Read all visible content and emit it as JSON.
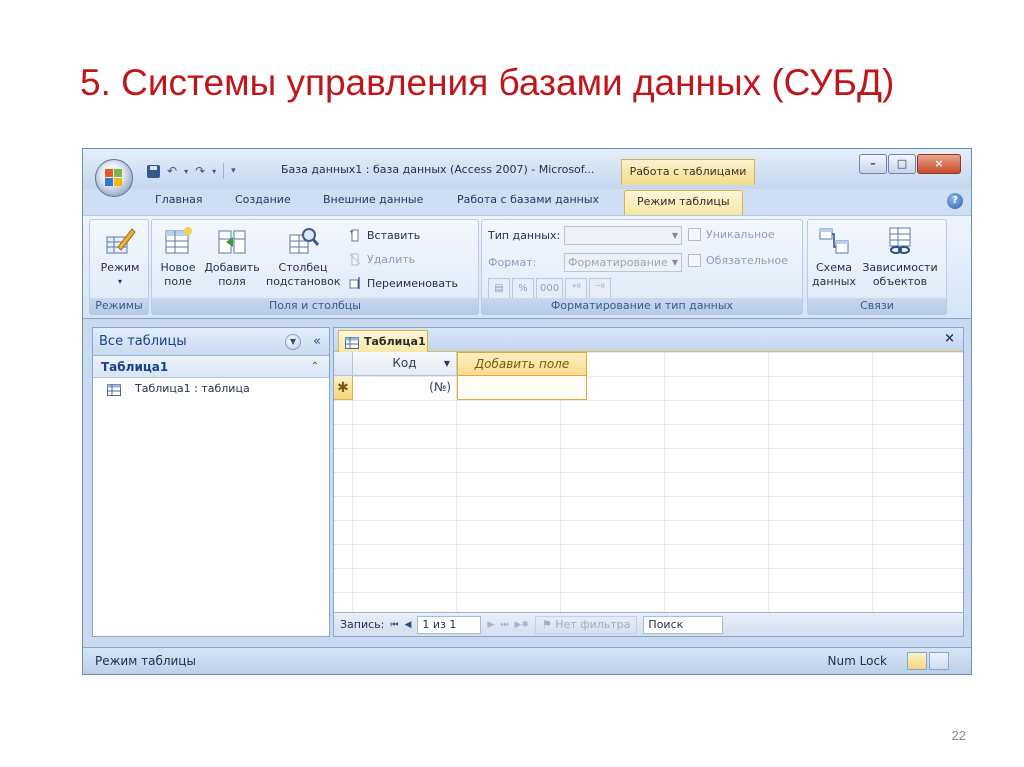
{
  "slide": {
    "title": "5. Системы управления базами данных (СУБД)",
    "page_number": "22"
  },
  "window": {
    "title": "База данных1 : база данных (Access 2007) - Microsof...",
    "context_tab": "Работа с таблицами",
    "controls": {
      "minimize": "–",
      "maximize": "□",
      "close": "×"
    }
  },
  "ribbon": {
    "tabs": [
      "Главная",
      "Создание",
      "Внешние данные",
      "Работа с базами данных",
      "Режим таблицы"
    ],
    "active_tab": "Режим таблицы",
    "groups": {
      "views": {
        "label": "Режимы",
        "mode_button": "Режим"
      },
      "fields": {
        "label": "Поля и столбцы",
        "new_field": [
          "Новое",
          "поле"
        ],
        "add_fields": [
          "Добавить",
          "поля"
        ],
        "lookup_column": [
          "Столбец",
          "подстановок"
        ],
        "insert": "Вставить",
        "delete": "Удалить",
        "rename": "Переименовать"
      },
      "format": {
        "label": "Форматирование и тип данных",
        "data_type_label": "Тип данных:",
        "data_type_value": "",
        "format_label": "Формат:",
        "format_value": "Форматирование",
        "unique": "Уникальное",
        "required": "Обязательное",
        "percent": "%",
        "thousands": "000"
      },
      "relations": {
        "label": "Связи",
        "schema": [
          "Схема",
          "данных"
        ],
        "dependencies": [
          "Зависимости",
          "объектов"
        ]
      }
    }
  },
  "nav_pane": {
    "header": "Все таблицы",
    "group": "Таблица1",
    "items": [
      {
        "label": "Таблица1 : таблица"
      }
    ]
  },
  "document": {
    "tab": "Таблица1",
    "columns": [
      "Код",
      "Добавить поле"
    ],
    "new_row_marker": "✱",
    "new_row_value": "(№)",
    "record_nav": {
      "label": "Запись:",
      "position": "1 из 1",
      "filter": "Нет фильтра",
      "search": "Поиск"
    }
  },
  "statusbar": {
    "left": "Режим таблицы",
    "num_lock": "Num Lock"
  },
  "colors": {
    "title_red": "#c0161b",
    "ribbon_blue": "#c9daf0",
    "accent_gold": "#f6d77e"
  }
}
